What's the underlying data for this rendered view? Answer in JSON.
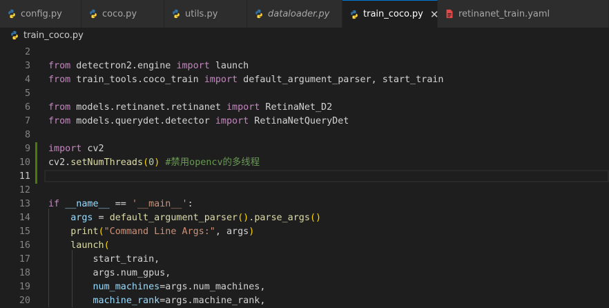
{
  "tabs": [
    {
      "label": "config.py",
      "icon": "python-icon",
      "italic": false,
      "active": false,
      "width": 118
    },
    {
      "label": "coco.py",
      "icon": "python-icon",
      "italic": false,
      "active": false,
      "width": 120
    },
    {
      "label": "utils.py",
      "icon": "python-icon",
      "italic": false,
      "active": false,
      "width": 120
    },
    {
      "label": "dataloader.py",
      "icon": "python-icon",
      "italic": true,
      "active": false,
      "width": 138
    },
    {
      "label": "train_coco.py",
      "icon": "python-icon",
      "italic": false,
      "active": true,
      "width": 138
    },
    {
      "label": "retinanet_train.yaml",
      "icon": "yaml-icon",
      "italic": false,
      "active": false,
      "width": 248
    }
  ],
  "close_glyph": "✕",
  "breadcrumb": {
    "file": "train_coco.py"
  },
  "lines": [
    {
      "n": "2",
      "tokens": []
    },
    {
      "n": "3",
      "tokens": [
        [
          "kw",
          "from"
        ],
        [
          "txt",
          " detectron2.engine "
        ],
        [
          "kw",
          "import"
        ],
        [
          "txt",
          " launch"
        ]
      ]
    },
    {
      "n": "4",
      "tokens": [
        [
          "kw",
          "from"
        ],
        [
          "txt",
          " train_tools.coco_train "
        ],
        [
          "kw",
          "import"
        ],
        [
          "txt",
          " default_argument_parser, start_train"
        ]
      ]
    },
    {
      "n": "5",
      "tokens": []
    },
    {
      "n": "6",
      "tokens": [
        [
          "kw",
          "from"
        ],
        [
          "txt",
          " models.retinanet.retinanet "
        ],
        [
          "kw",
          "import"
        ],
        [
          "txt",
          " RetinaNet_D2"
        ]
      ]
    },
    {
      "n": "7",
      "tokens": [
        [
          "kw",
          "from"
        ],
        [
          "txt",
          " models.querydet.detector "
        ],
        [
          "kw",
          "import"
        ],
        [
          "txt",
          " RetinaNetQueryDet"
        ]
      ]
    },
    {
      "n": "8",
      "tokens": []
    },
    {
      "n": "9",
      "tokens": [
        [
          "kw",
          "import"
        ],
        [
          "txt",
          " cv2"
        ]
      ]
    },
    {
      "n": "10",
      "tokens": [
        [
          "txt",
          "cv2."
        ],
        [
          "fn",
          "setNumThreads"
        ],
        [
          "p1",
          "("
        ],
        [
          "num",
          "0"
        ],
        [
          "p1",
          ")"
        ],
        [
          "txt",
          " "
        ],
        [
          "cm",
          "#禁用opencv的多线程"
        ]
      ]
    },
    {
      "n": "11",
      "tokens": [],
      "current": true
    },
    {
      "n": "12",
      "tokens": []
    },
    {
      "n": "13",
      "tokens": [
        [
          "kw",
          "if"
        ],
        [
          "txt",
          " "
        ],
        [
          "var",
          "__name__"
        ],
        [
          "txt",
          " == "
        ],
        [
          "str",
          "'__main__'"
        ],
        [
          "txt",
          ":"
        ]
      ]
    },
    {
      "n": "14",
      "tokens": [
        [
          "txt",
          "    "
        ],
        [
          "var",
          "args"
        ],
        [
          "txt",
          " = "
        ],
        [
          "fn",
          "default_argument_parser"
        ],
        [
          "p1",
          "()"
        ],
        [
          "txt",
          "."
        ],
        [
          "fn",
          "parse_args"
        ],
        [
          "p1",
          "()"
        ]
      ]
    },
    {
      "n": "15",
      "tokens": [
        [
          "txt",
          "    "
        ],
        [
          "fn",
          "print"
        ],
        [
          "p1",
          "("
        ],
        [
          "str",
          "\"Command Line Args:\""
        ],
        [
          "txt",
          ", args"
        ],
        [
          "p1",
          ")"
        ]
      ]
    },
    {
      "n": "16",
      "tokens": [
        [
          "txt",
          "    "
        ],
        [
          "fn",
          "launch"
        ],
        [
          "p1",
          "("
        ]
      ]
    },
    {
      "n": "17",
      "tokens": [
        [
          "txt",
          "        start_train,"
        ]
      ]
    },
    {
      "n": "18",
      "tokens": [
        [
          "txt",
          "        args.num_gpus,"
        ]
      ]
    },
    {
      "n": "19",
      "tokens": [
        [
          "txt",
          "        "
        ],
        [
          "var",
          "num_machines"
        ],
        [
          "txt",
          "=args.num_machines,"
        ]
      ]
    },
    {
      "n": "20",
      "tokens": [
        [
          "txt",
          "        "
        ],
        [
          "var",
          "machine_rank"
        ],
        [
          "txt",
          "=args.machine_rank,"
        ]
      ]
    }
  ],
  "colors": {
    "accent": "#0078d4",
    "git_added": "#487e02",
    "python_blue": "#3572a5",
    "python_yellow": "#ffd43b",
    "yaml_red": "#e44c4c"
  }
}
